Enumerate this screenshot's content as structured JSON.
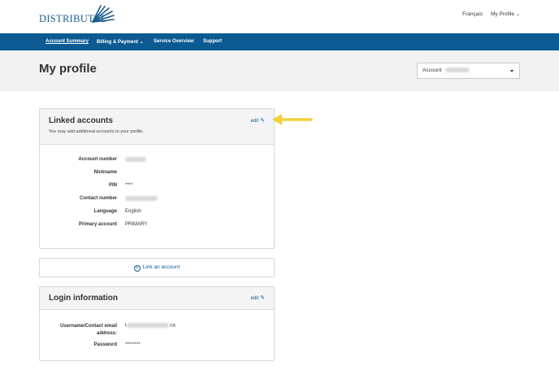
{
  "header": {
    "logo_text": "DISTRIBUTEL",
    "lang_link": "Français",
    "profile_link": "My Profile"
  },
  "nav": {
    "items": [
      "Account Summary",
      "Billing & Payment",
      "Service Overview",
      "Support"
    ]
  },
  "banner": {
    "title": "My profile",
    "account_label": "Account"
  },
  "linked_accounts": {
    "title": "Linked accounts",
    "subtitle": "You may add additional accounts to your profile.",
    "edit": "edit",
    "rows": [
      {
        "label": "Account number",
        "value": ""
      },
      {
        "label": "Nickname",
        "value": ""
      },
      {
        "label": "PIN",
        "value": "****"
      },
      {
        "label": "Contact number",
        "value": ""
      },
      {
        "label": "Language",
        "value": "English"
      },
      {
        "label": "Primary account",
        "value": "PRIMARY"
      }
    ]
  },
  "link_account": {
    "label": "Link an account"
  },
  "login_info": {
    "title": "Login information",
    "edit": "edit",
    "email_label_1": "Username/Contact email",
    "email_label_2": "address:",
    "email_prefix": "t",
    "email_suffix": ".ca",
    "password_label": "Password",
    "password_value": "********"
  },
  "colors": {
    "brand_blue": "#0b5a92",
    "arrow_yellow": "#f2d13a"
  }
}
